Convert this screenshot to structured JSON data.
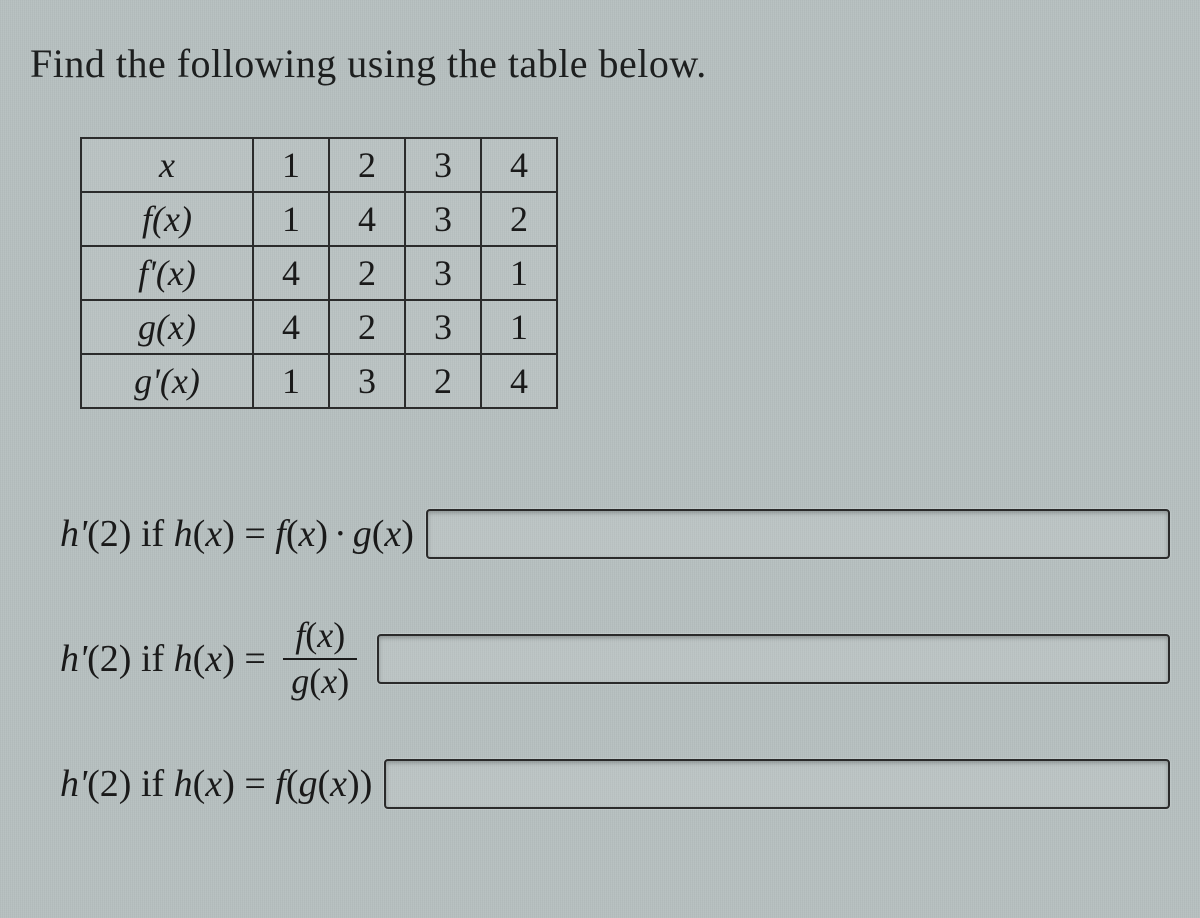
{
  "prompt": "Find the following using the table below.",
  "table": {
    "rows": [
      {
        "label": "x",
        "values": [
          "1",
          "2",
          "3",
          "4"
        ]
      },
      {
        "label": "f(x)",
        "values": [
          "1",
          "4",
          "3",
          "2"
        ]
      },
      {
        "label": "f'(x)",
        "values": [
          "4",
          "2",
          "3",
          "1"
        ]
      },
      {
        "label": "g(x)",
        "values": [
          "4",
          "2",
          "3",
          "1"
        ]
      },
      {
        "label": "g'(x)",
        "values": [
          "1",
          "3",
          "2",
          "4"
        ]
      }
    ]
  },
  "questions": {
    "q1": {
      "lead": "h'(2) if h(x) = f(x) · g(x)",
      "value": ""
    },
    "q2": {
      "lead": "h'(2) if h(x) = f(x) / g(x)",
      "value": ""
    },
    "q3": {
      "lead": "h'(2) if h(x) = f(g(x))",
      "value": ""
    }
  },
  "chart_data": {
    "type": "table",
    "columns": [
      "x",
      "f(x)",
      "f'(x)",
      "g(x)",
      "g'(x)"
    ],
    "rows": [
      {
        "x": 1,
        "f(x)": 1,
        "f'(x)": 4,
        "g(x)": 4,
        "g'(x)": 1
      },
      {
        "x": 2,
        "f(x)": 4,
        "f'(x)": 2,
        "g(x)": 2,
        "g'(x)": 3
      },
      {
        "x": 3,
        "f(x)": 3,
        "f'(x)": 3,
        "g(x)": 3,
        "g'(x)": 2
      },
      {
        "x": 4,
        "f(x)": 2,
        "f'(x)": 1,
        "g(x)": 1,
        "g'(x)": 4
      }
    ]
  }
}
